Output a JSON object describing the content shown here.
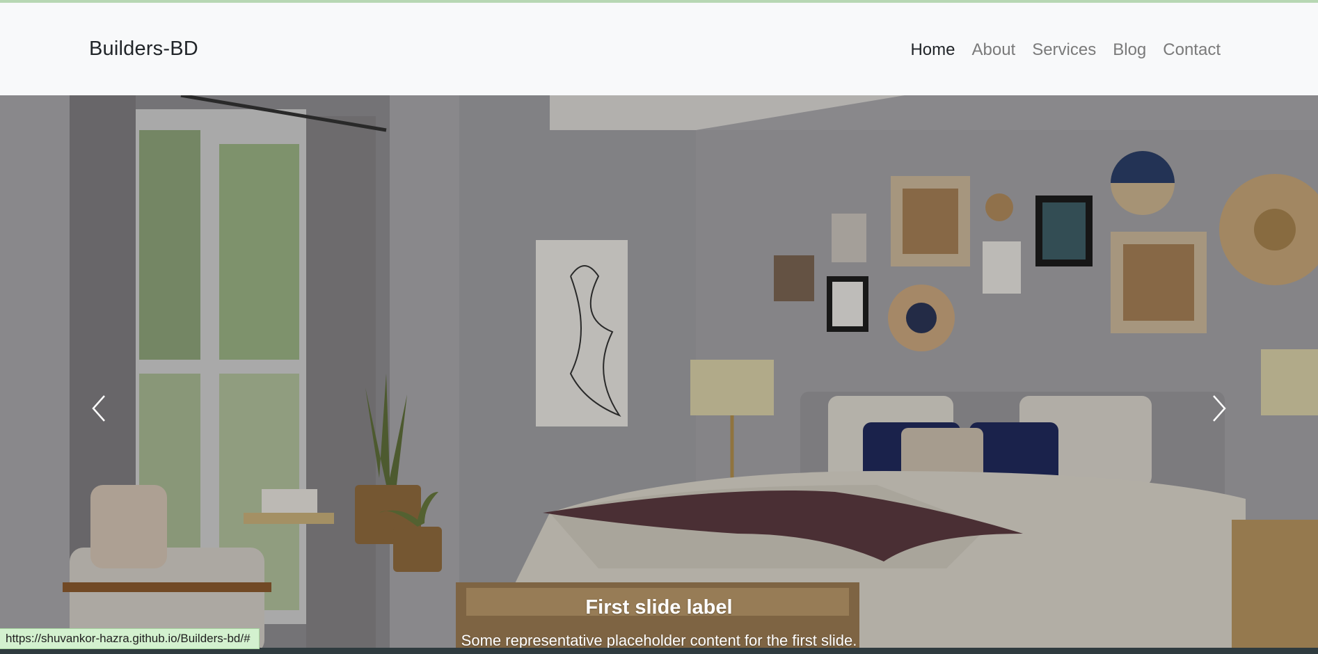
{
  "navbar": {
    "brand": "Builders-BD",
    "links": [
      {
        "label": "Home",
        "active": true
      },
      {
        "label": "About",
        "active": false
      },
      {
        "label": "Services",
        "active": false
      },
      {
        "label": "Blog",
        "active": false
      },
      {
        "label": "Contact",
        "active": false
      }
    ]
  },
  "carousel": {
    "slide_title": "First slide label",
    "slide_text": "Some representative placeholder content for the first slide.",
    "prev_icon": "chevron-left-icon",
    "next_icon": "chevron-right-icon"
  },
  "status_bar": {
    "url": "https://shuvankor-hazra.github.io/Builders-bd/#"
  },
  "colors": {
    "navbar_bg": "#f8f9fa",
    "brand_text": "#212529",
    "nav_inactive": "#7a7a7a",
    "status_bg": "#d3f1cf"
  }
}
